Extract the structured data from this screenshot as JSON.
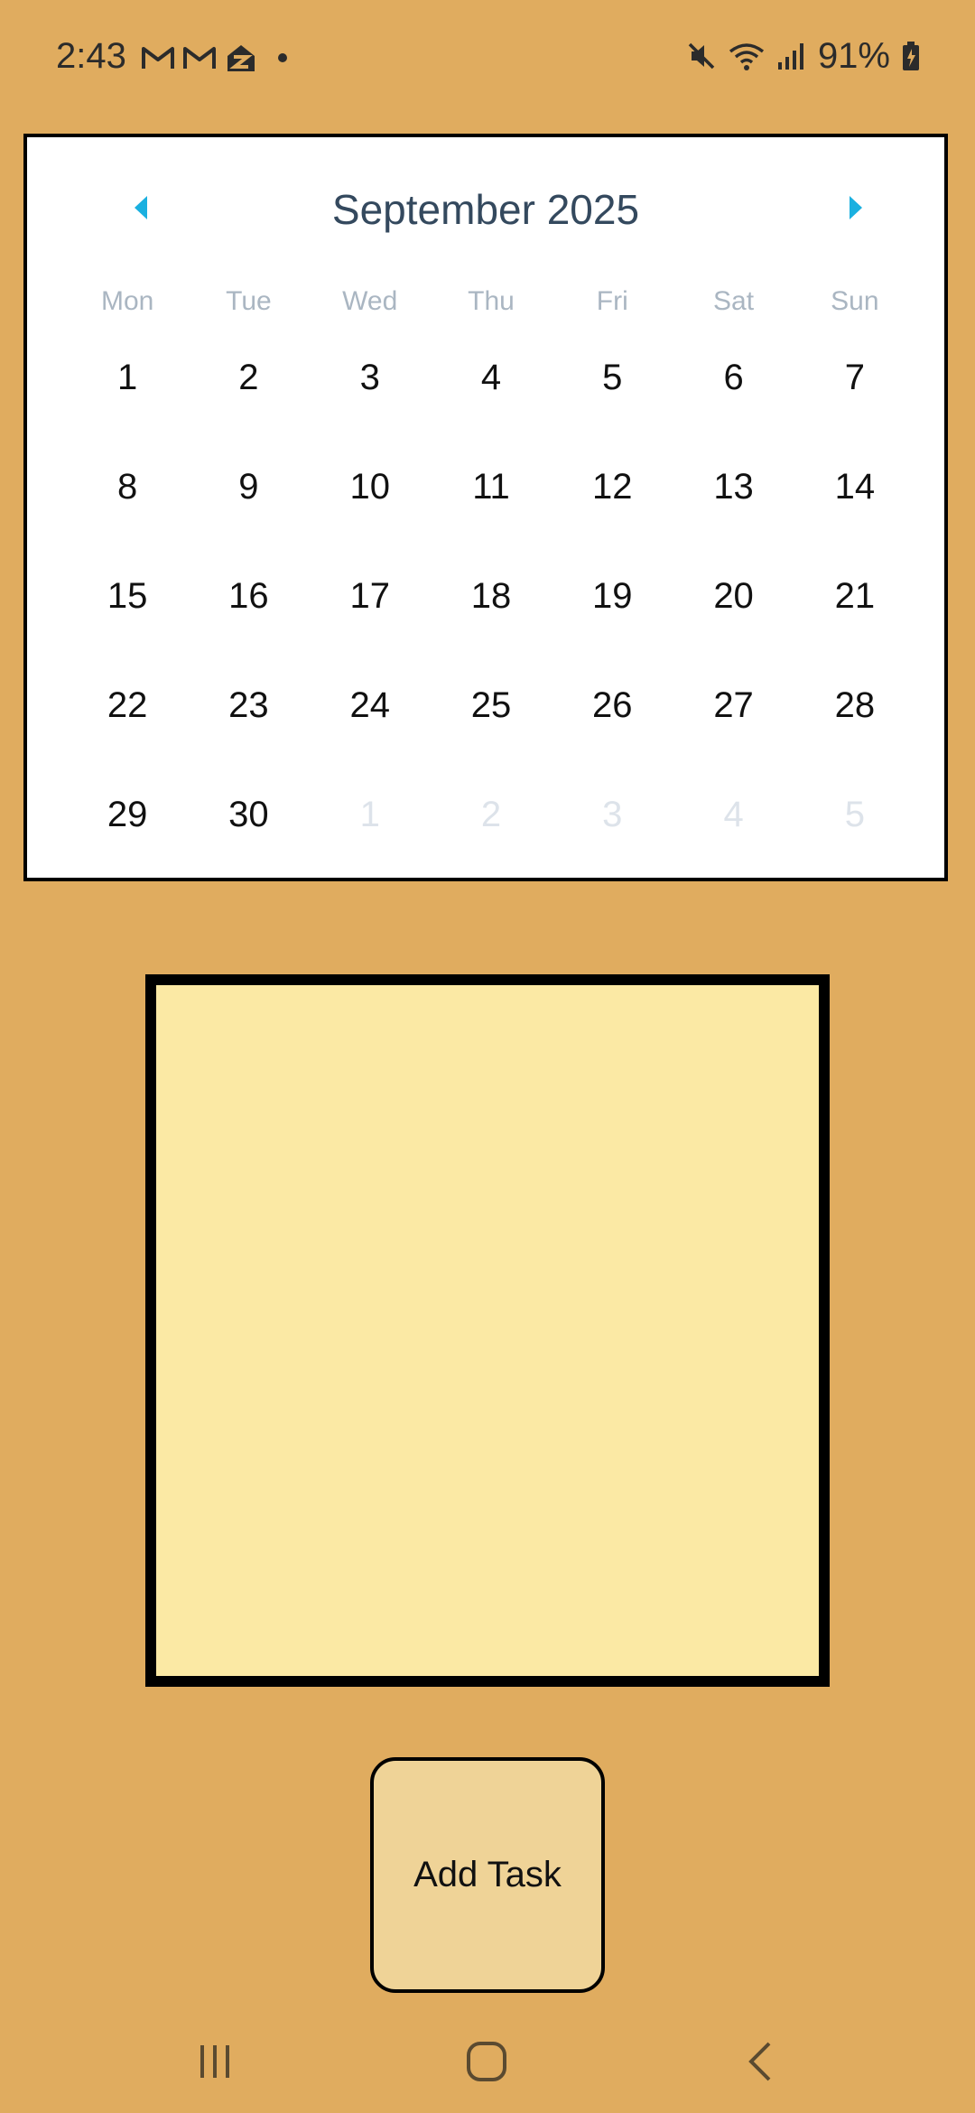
{
  "status_bar": {
    "time": "2:43",
    "battery_percent": "91%",
    "left_icons": [
      "gmail-icon",
      "gmail-icon",
      "zillow-icon",
      "notification-dot"
    ],
    "right_icons": [
      "mute-icon",
      "wifi-icon",
      "signal-icon",
      "battery-charging-icon"
    ]
  },
  "calendar": {
    "month_title": "September 2025",
    "prev_icon": "chevron-left-icon",
    "next_icon": "chevron-right-icon",
    "weekdays": [
      "Mon",
      "Tue",
      "Wed",
      "Thu",
      "Fri",
      "Sat",
      "Sun"
    ],
    "days": [
      {
        "label": "1",
        "in_month": true
      },
      {
        "label": "2",
        "in_month": true
      },
      {
        "label": "3",
        "in_month": true
      },
      {
        "label": "4",
        "in_month": true
      },
      {
        "label": "5",
        "in_month": true
      },
      {
        "label": "6",
        "in_month": true
      },
      {
        "label": "7",
        "in_month": true
      },
      {
        "label": "8",
        "in_month": true
      },
      {
        "label": "9",
        "in_month": true
      },
      {
        "label": "10",
        "in_month": true
      },
      {
        "label": "11",
        "in_month": true
      },
      {
        "label": "12",
        "in_month": true
      },
      {
        "label": "13",
        "in_month": true
      },
      {
        "label": "14",
        "in_month": true
      },
      {
        "label": "15",
        "in_month": true
      },
      {
        "label": "16",
        "in_month": true
      },
      {
        "label": "17",
        "in_month": true
      },
      {
        "label": "18",
        "in_month": true
      },
      {
        "label": "19",
        "in_month": true
      },
      {
        "label": "20",
        "in_month": true
      },
      {
        "label": "21",
        "in_month": true
      },
      {
        "label": "22",
        "in_month": true
      },
      {
        "label": "23",
        "in_month": true
      },
      {
        "label": "24",
        "in_month": true
      },
      {
        "label": "25",
        "in_month": true
      },
      {
        "label": "26",
        "in_month": true
      },
      {
        "label": "27",
        "in_month": true
      },
      {
        "label": "28",
        "in_month": true
      },
      {
        "label": "29",
        "in_month": true
      },
      {
        "label": "30",
        "in_month": true
      },
      {
        "label": "1",
        "in_month": false
      },
      {
        "label": "2",
        "in_month": false
      },
      {
        "label": "3",
        "in_month": false
      },
      {
        "label": "4",
        "in_month": false
      },
      {
        "label": "5",
        "in_month": false
      }
    ],
    "colors": {
      "title": "#34495e",
      "arrow": "#1ab0e0",
      "weekday": "#aab6c2",
      "day": "#111111",
      "day_muted": "#dde3ea"
    }
  },
  "task_box": {
    "fill_color": "#FBE9A4"
  },
  "add_task_button": {
    "label": "Add Task"
  },
  "nav_bar": {
    "icons": [
      "recents-icon",
      "home-icon",
      "back-icon"
    ]
  },
  "colors": {
    "background": "#E0AC5F",
    "button_fill": "#EFD397"
  }
}
